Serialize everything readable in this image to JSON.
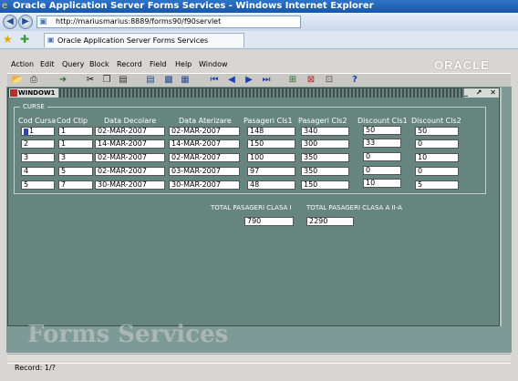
{
  "browser": {
    "title": "Oracle Application Server Forms Services - Windows Internet Explorer",
    "address": "http://mariusmarius:8889/forms90/f90servlet",
    "tab_label": "Oracle Application Server Forms Services"
  },
  "app": {
    "menu": [
      "Action",
      "Edit",
      "Query",
      "Block",
      "Record",
      "Field",
      "Help",
      "Window"
    ],
    "brand": "ORACLE",
    "toolbar_icons": [
      "open-icon",
      "print-icon",
      "exit-icon",
      "cut-icon",
      "copy-icon",
      "paste-icon",
      "query-icon",
      "execute-icon",
      "first-record-icon",
      "previous-icon",
      "next-icon",
      "last-record-icon",
      "insert-record-icon",
      "delete-record-icon",
      "lock-record-icon",
      "help-icon"
    ]
  },
  "window": {
    "title": "WINDOW1",
    "frame_title": "CURSE",
    "controls": "_ ↗ ✕"
  },
  "table": {
    "columns": [
      "Cod Cursa",
      "Cod Ctip",
      "Data Decolare",
      "Data Aterizare",
      "Pasageri Cls1",
      "Pasageri Cls2",
      "Discount Cls1",
      "Discount Cls2"
    ],
    "rows": [
      [
        "1",
        "1",
        "02-MAR-2007",
        "02-MAR-2007",
        "148",
        "340",
        "50",
        "50"
      ],
      [
        "2",
        "1",
        "14-MAR-2007",
        "14-MAR-2007",
        "150",
        "300",
        "33",
        "0"
      ],
      [
        "3",
        "3",
        "02-MAR-2007",
        "02-MAR-2007",
        "100",
        "350",
        "0",
        "10"
      ],
      [
        "4",
        "5",
        "02-MAR-2007",
        "03-MAR-2007",
        "97",
        "350",
        "0",
        "0"
      ],
      [
        "5",
        "7",
        "30-MAR-2007",
        "30-MAR-2007",
        "48",
        "150",
        "10",
        "5"
      ]
    ]
  },
  "totals": {
    "label_1": "TOTAL PASAGERI CLASA I",
    "value_1": "790",
    "label_2": "TOTAL PASAGERI CLASA A II-A",
    "value_2": "2290"
  },
  "watermark": "Forms Services",
  "status": "Record: 1/?",
  "colors": {
    "title_bar": "#1a56a8",
    "canvas": "#67857f",
    "mdi_background": "#7e9a97",
    "current_record_marker": "#2a48a8"
  }
}
